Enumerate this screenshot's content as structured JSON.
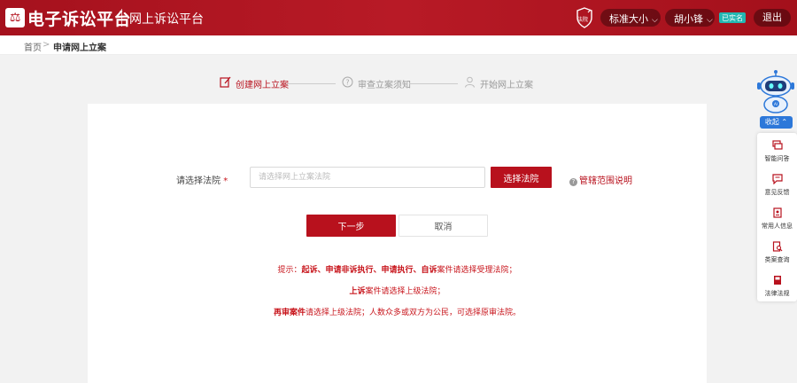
{
  "header": {
    "app_title": "电子诉讼平台",
    "sub_title": "网上诉讼平台",
    "badge_text": "法院",
    "font_size_label": "标准大小",
    "user_name": "胡小锋",
    "verified_label": "已实名",
    "logout_label": "退出",
    "accent_color": "#b3121e"
  },
  "breadcrumb": {
    "home": "首页",
    "separator": ">",
    "current": "申请网上立案"
  },
  "steps": [
    {
      "label": "创建网上立案",
      "state": "active",
      "icon": "edit-icon"
    },
    {
      "label": "审查立案须知",
      "state": "pending",
      "icon": "question-circle-icon"
    },
    {
      "label": "开始网上立案",
      "state": "pending",
      "icon": "user-icon"
    }
  ],
  "form": {
    "court_label": "请选择法院",
    "required_mark": "*",
    "court_placeholder": "请选择网上立案法院",
    "court_value": "",
    "select_court_button": "选择法院",
    "jurisdiction_help": "管辖范围说明",
    "next_button": "下一步",
    "cancel_button": "取消"
  },
  "tips": {
    "line1_prefix": "提示：",
    "line1_bold": "起诉、申请非诉执行、申请执行、自诉",
    "line1_rest": "案件请选择受理法院；",
    "line2_bold": "上诉",
    "line2_rest": "案件请选择上级法院；",
    "line3_bold": "再审案件",
    "line3_rest": "请选择上级法院；人数众多或双方为公民，可选择原审法院。"
  },
  "assistant": {
    "collapse_label": "收起",
    "robot_badge": "AI",
    "items": [
      {
        "label": "智能问答",
        "icon": "chat-icon"
      },
      {
        "label": "意见反馈",
        "icon": "feedback-icon"
      },
      {
        "label": "常用人信息",
        "icon": "contact-card-icon"
      },
      {
        "label": "类案查询",
        "icon": "case-search-icon"
      },
      {
        "label": "法律法规",
        "icon": "law-book-icon"
      }
    ]
  }
}
